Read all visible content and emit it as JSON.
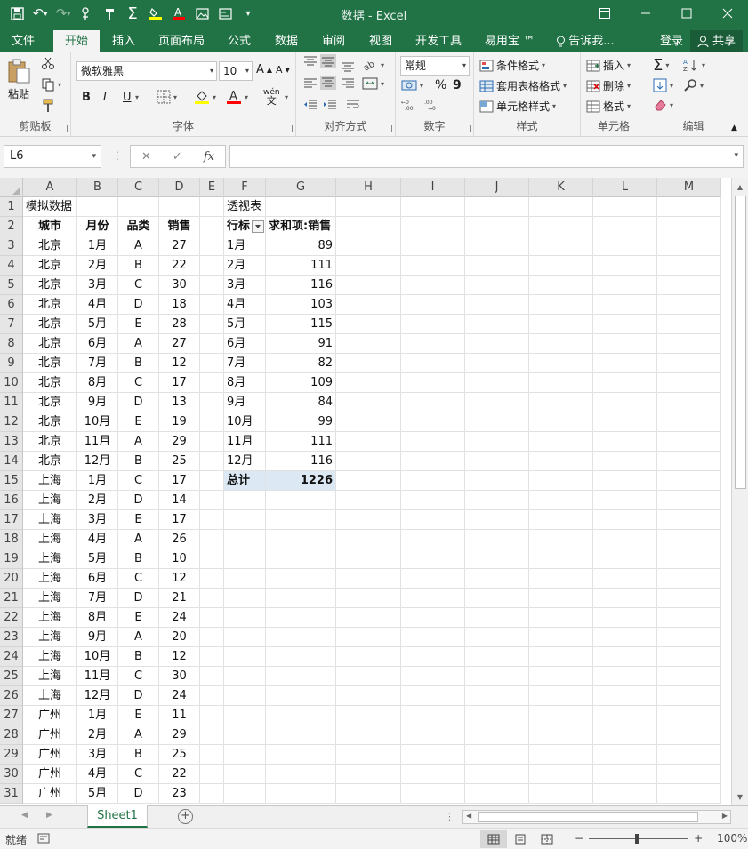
{
  "titlebar": {
    "title": "数据 - Excel",
    "qat": [
      "save-icon",
      "undo-icon",
      "redo-icon",
      "touch-mode-icon",
      "format-painter-icon",
      "sum-icon",
      "highlight-icon",
      "font-color-icon",
      "insert-picture-icon",
      "screenshot-icon",
      "customize-qat-icon"
    ]
  },
  "tabs": {
    "items": [
      "文件",
      "开始",
      "插入",
      "页面布局",
      "公式",
      "数据",
      "审阅",
      "视图",
      "开发工具",
      "易用宝 ™",
      "告诉我..."
    ],
    "active": "开始",
    "login": "登录",
    "share": "共享"
  },
  "ribbon": {
    "clipboard": {
      "paste": "粘贴",
      "label": "剪贴板"
    },
    "font": {
      "name": "微软雅黑",
      "size": "10",
      "bold": "B",
      "italic": "I",
      "underline": "U",
      "label": "字体",
      "wen": "wén",
      "wen_zh": "文"
    },
    "align": {
      "label": "对齐方式"
    },
    "number": {
      "format": "常规",
      "percent": "%",
      "comma": "9",
      "label": "数字"
    },
    "styles": {
      "conditional": "条件格式",
      "table": "套用表格格式",
      "cell": "单元格样式",
      "label": "样式"
    },
    "cells": {
      "insert": "插入",
      "delete": "删除",
      "format": "格式",
      "label": "单元格"
    },
    "editing": {
      "label": "编辑"
    }
  },
  "formula_bar": {
    "name_box": "L6",
    "fx": "fx",
    "formula": ""
  },
  "grid": {
    "columns": [
      "A",
      "B",
      "C",
      "D",
      "E",
      "F",
      "G",
      "H",
      "I",
      "J",
      "K",
      "L",
      "M"
    ],
    "rows": [
      "1",
      "2",
      "3",
      "4",
      "5",
      "6",
      "7",
      "8",
      "9",
      "10",
      "11",
      "12",
      "13",
      "14",
      "15",
      "16",
      "17",
      "18",
      "19",
      "20",
      "21",
      "22",
      "23",
      "24",
      "25",
      "26",
      "27",
      "28",
      "29",
      "30",
      "31"
    ],
    "source_title": "模拟数据",
    "source_headers": [
      "城市",
      "月份",
      "品类",
      "销售"
    ],
    "source_rows": [
      [
        "北京",
        "1月",
        "A",
        "27"
      ],
      [
        "北京",
        "2月",
        "B",
        "22"
      ],
      [
        "北京",
        "3月",
        "C",
        "30"
      ],
      [
        "北京",
        "4月",
        "D",
        "18"
      ],
      [
        "北京",
        "5月",
        "E",
        "28"
      ],
      [
        "北京",
        "6月",
        "A",
        "27"
      ],
      [
        "北京",
        "7月",
        "B",
        "12"
      ],
      [
        "北京",
        "8月",
        "C",
        "17"
      ],
      [
        "北京",
        "9月",
        "D",
        "13"
      ],
      [
        "北京",
        "10月",
        "E",
        "19"
      ],
      [
        "北京",
        "11月",
        "A",
        "29"
      ],
      [
        "北京",
        "12月",
        "B",
        "25"
      ],
      [
        "上海",
        "1月",
        "C",
        "17"
      ],
      [
        "上海",
        "2月",
        "D",
        "14"
      ],
      [
        "上海",
        "3月",
        "E",
        "17"
      ],
      [
        "上海",
        "4月",
        "A",
        "26"
      ],
      [
        "上海",
        "5月",
        "B",
        "10"
      ],
      [
        "上海",
        "6月",
        "C",
        "12"
      ],
      [
        "上海",
        "7月",
        "D",
        "21"
      ],
      [
        "上海",
        "8月",
        "E",
        "24"
      ],
      [
        "上海",
        "9月",
        "A",
        "20"
      ],
      [
        "上海",
        "10月",
        "B",
        "12"
      ],
      [
        "上海",
        "11月",
        "C",
        "30"
      ],
      [
        "上海",
        "12月",
        "D",
        "24"
      ],
      [
        "广州",
        "1月",
        "E",
        "11"
      ],
      [
        "广州",
        "2月",
        "A",
        "29"
      ],
      [
        "广州",
        "3月",
        "B",
        "25"
      ],
      [
        "广州",
        "4月",
        "C",
        "22"
      ],
      [
        "广州",
        "5月",
        "D",
        "23"
      ]
    ],
    "pivot_title": "透视表",
    "pivot_headers": [
      "行标",
      "求和项:销售"
    ],
    "pivot_rows": [
      [
        "1月",
        "89"
      ],
      [
        "2月",
        "111"
      ],
      [
        "3月",
        "116"
      ],
      [
        "4月",
        "103"
      ],
      [
        "5月",
        "115"
      ],
      [
        "6月",
        "91"
      ],
      [
        "7月",
        "82"
      ],
      [
        "8月",
        "109"
      ],
      [
        "9月",
        "84"
      ],
      [
        "10月",
        "99"
      ],
      [
        "11月",
        "111"
      ],
      [
        "12月",
        "116"
      ]
    ],
    "pivot_total": [
      "总计",
      "1226"
    ]
  },
  "sheets": {
    "active": "Sheet1",
    "add": "+"
  },
  "status": {
    "ready": "就绪",
    "zoom": "100%",
    "minus": "−",
    "plus": "+"
  },
  "colors": {
    "accent": "#217346",
    "pivot_total_bg": "#dce9f5"
  }
}
